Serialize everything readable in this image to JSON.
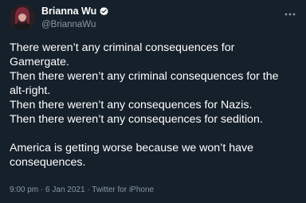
{
  "author": {
    "display_name": "Brianna Wu",
    "handle": "@BriannaWu",
    "verified_icon": "verified-badge-icon",
    "avatar_icon": "avatar"
  },
  "tweet": {
    "lines": [
      "There weren’t any criminal consequences for",
      "Gamergate.",
      "Then there weren’t any criminal consequences for the",
      "alt-right.",
      "Then there weren’t any consequences for Nazis.",
      "Then there weren’t any consequences for sedition.",
      "",
      "America is getting worse because we won’t have",
      "consequences."
    ]
  },
  "meta": {
    "time": "9:00 pm",
    "separator1": "·",
    "date": "6 Jan 2021",
    "separator2": "·",
    "source": "Twitter for iPhone"
  },
  "colors": {
    "background": "#15202b",
    "text": "#ffffff",
    "secondary": "#8899a6",
    "verified": "#1da1f2"
  }
}
